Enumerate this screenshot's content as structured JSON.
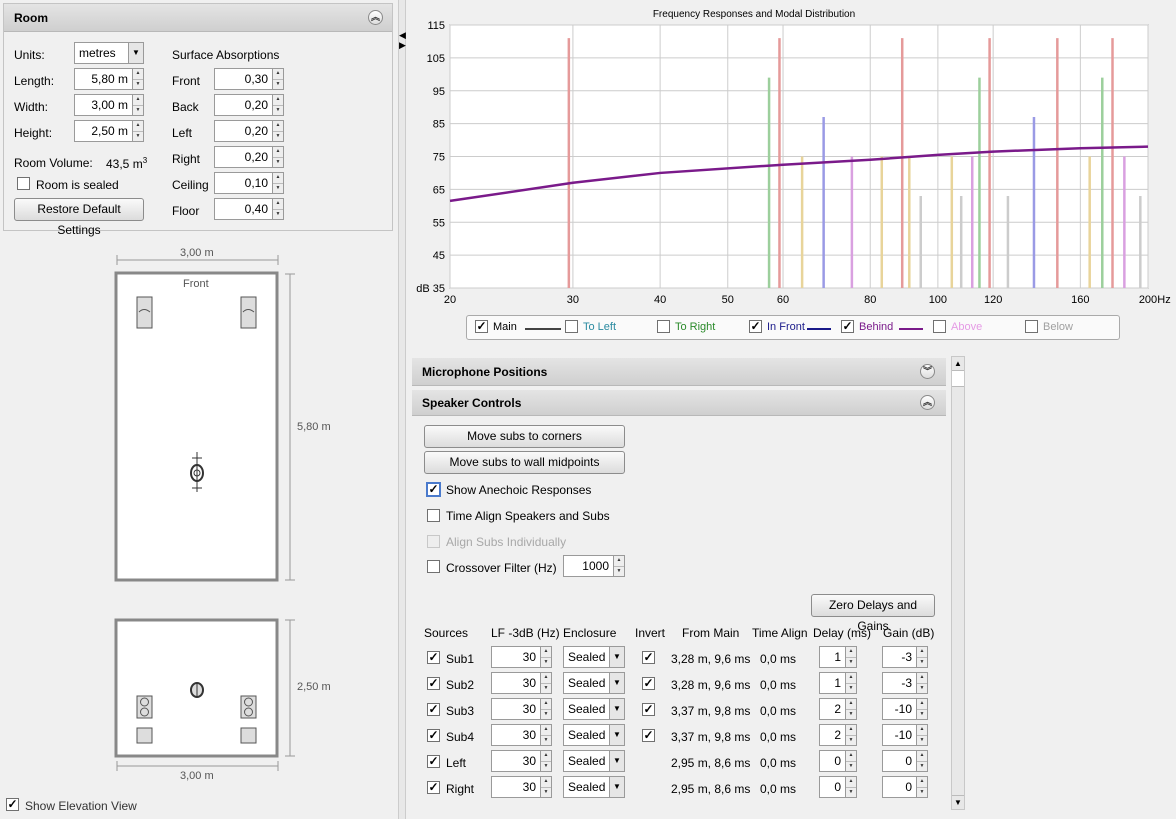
{
  "room_panel": {
    "title": "Room",
    "units_label": "Units:",
    "units_value": "metres",
    "length_label": "Length:",
    "length_value": "5,80 m",
    "width_label": "Width:",
    "width_value": "3,00 m",
    "height_label": "Height:",
    "height_value": "2,50 m",
    "volume_label": "Room Volume:",
    "volume_value": "43,5 m",
    "volume_sup": "3",
    "sealed_label": "Room is sealed",
    "restore_label": "Restore Default Settings",
    "absorb_title": "Surface Absorptions",
    "surfaces": [
      {
        "label": "Front",
        "value": "0,30"
      },
      {
        "label": "Back",
        "value": "0,20"
      },
      {
        "label": "Left",
        "value": "0,20"
      },
      {
        "label": "Right",
        "value": "0,20"
      },
      {
        "label": "Ceiling",
        "value": "0,10"
      },
      {
        "label": "Floor",
        "value": "0,40"
      }
    ]
  },
  "plan_view": {
    "top_dim": "3,00 m",
    "side_dim": "5,80 m",
    "front_label": "Front"
  },
  "elev_view": {
    "side_dim": "2,50 m",
    "bottom_dim": "3,00 m",
    "show_label": "Show Elevation View",
    "show_checked": true
  },
  "chart": {
    "title": "Frequency Responses and Modal Distribution",
    "y_unit": "dB",
    "x_unit": "Hz",
    "y_ticks": [
      "115",
      "105",
      "95",
      "85",
      "75",
      "65",
      "55",
      "45",
      "35"
    ],
    "x_ticks": [
      "20",
      "30",
      "40",
      "50",
      "60",
      "80",
      "100",
      "120",
      "160",
      "200"
    ]
  },
  "chart_data": {
    "type": "line",
    "title": "Frequency Responses and Modal Distribution",
    "xlabel": "Hz",
    "ylabel": "dB",
    "xlim": [
      20,
      200
    ],
    "ylim": [
      35,
      115
    ],
    "x_scale": "log",
    "grid": true,
    "legend_position": "bottom",
    "series": [
      {
        "name": "Behind",
        "color": "#7a1a8a",
        "x": [
          20,
          30,
          40,
          60,
          80,
          100,
          120,
          160,
          200
        ],
        "y": [
          61.5,
          67,
          70,
          72.5,
          74,
          75.5,
          76.5,
          77.5,
          78
        ]
      }
    ],
    "modes": [
      {
        "freq": 29.6,
        "level": 111,
        "color": "#e59a9a"
      },
      {
        "freq": 57.3,
        "level": 99,
        "color": "#9ccf9c"
      },
      {
        "freq": 59.3,
        "level": 111,
        "color": "#e59a9a"
      },
      {
        "freq": 63.9,
        "level": 75,
        "color": "#e8d49a"
      },
      {
        "freq": 68.6,
        "level": 87,
        "color": "#9a9ae5"
      },
      {
        "freq": 75.3,
        "level": 75,
        "color": "#d9a0e0"
      },
      {
        "freq": 83.1,
        "level": 75,
        "color": "#e8d49a"
      },
      {
        "freq": 88.9,
        "level": 111,
        "color": "#e59a9a"
      },
      {
        "freq": 91,
        "level": 75,
        "color": "#e8d49a"
      },
      {
        "freq": 94.5,
        "level": 63,
        "color": "#cccccc"
      },
      {
        "freq": 104.7,
        "level": 75,
        "color": "#e8d49a"
      },
      {
        "freq": 108,
        "level": 63,
        "color": "#cccccc"
      },
      {
        "freq": 112,
        "level": 75,
        "color": "#d9a0e0"
      },
      {
        "freq": 114.7,
        "level": 99,
        "color": "#9ccf9c"
      },
      {
        "freq": 118.6,
        "level": 111,
        "color": "#e59a9a"
      },
      {
        "freq": 126,
        "level": 63,
        "color": "#cccccc"
      },
      {
        "freq": 137.3,
        "level": 87,
        "color": "#9a9ae5"
      },
      {
        "freq": 148.3,
        "level": 111,
        "color": "#e59a9a"
      },
      {
        "freq": 165,
        "level": 75,
        "color": "#e8d49a"
      },
      {
        "freq": 172,
        "level": 99,
        "color": "#9ccf9c"
      },
      {
        "freq": 177.9,
        "level": 111,
        "color": "#e59a9a"
      },
      {
        "freq": 185,
        "level": 75,
        "color": "#d9a0e0"
      },
      {
        "freq": 195,
        "level": 63,
        "color": "#cccccc"
      }
    ]
  },
  "legend": [
    {
      "label": "Main",
      "checked": true,
      "color": "#444444",
      "line": true,
      "text_color": "#000000"
    },
    {
      "label": "To Left",
      "checked": false,
      "color": "#2a8aa0",
      "line": false,
      "text_color": "#2a8aa0"
    },
    {
      "label": "To Right",
      "checked": false,
      "color": "#2a8a2a",
      "line": false,
      "text_color": "#2a8a2a"
    },
    {
      "label": "In Front",
      "checked": true,
      "color": "#1a1a8a",
      "line": true,
      "text_color": "#1a1a8a"
    },
    {
      "label": "Behind",
      "checked": true,
      "color": "#7a1a8a",
      "line": true,
      "text_color": "#7a1a8a"
    },
    {
      "label": "Above",
      "checked": false,
      "color": "#e59ae5",
      "line": false,
      "text_color": "#e59ae5"
    },
    {
      "label": "Below",
      "checked": false,
      "color": "#a0a0a0",
      "line": false,
      "text_color": "#a0a0a0"
    }
  ],
  "mic_panel": {
    "title": "Microphone Positions"
  },
  "speaker_panel": {
    "title": "Speaker Controls",
    "btn_corners": "Move subs to corners",
    "btn_midpoints": "Move subs to wall midpoints",
    "anechoic_label": "Show Anechoic Responses",
    "time_align_label": "Time Align Speakers and Subs",
    "align_subs_label": "Align Subs Individually",
    "crossover_label": "Crossover Filter (Hz)",
    "crossover_value": "1000",
    "zero_label": "Zero Delays and Gains",
    "headers": [
      "Sources",
      "LF -3dB (Hz)",
      "Enclosure",
      "Invert",
      "From Main",
      "Time Align",
      "Delay (ms)",
      "Gain (dB)"
    ],
    "rows": [
      {
        "name": "Sub1",
        "lf": "30",
        "enclosure": "Sealed",
        "invert": true,
        "from_main": "3,28 m, 9,6 ms",
        "time_align": "0,0 ms",
        "delay": "1",
        "gain": "-3"
      },
      {
        "name": "Sub2",
        "lf": "30",
        "enclosure": "Sealed",
        "invert": true,
        "from_main": "3,28 m, 9,6 ms",
        "time_align": "0,0 ms",
        "delay": "1",
        "gain": "-3"
      },
      {
        "name": "Sub3",
        "lf": "30",
        "enclosure": "Sealed",
        "invert": true,
        "from_main": "3,37 m, 9,8 ms",
        "time_align": "0,0 ms",
        "delay": "2",
        "gain": "-10"
      },
      {
        "name": "Sub4",
        "lf": "30",
        "enclosure": "Sealed",
        "invert": true,
        "from_main": "3,37 m, 9,8 ms",
        "time_align": "0,0 ms",
        "delay": "2",
        "gain": "-10"
      },
      {
        "name": "Left",
        "lf": "30",
        "enclosure": "Sealed",
        "invert": false,
        "from_main": "2,95 m, 8,6 ms",
        "time_align": "0,0 ms",
        "delay": "0",
        "gain": "0"
      },
      {
        "name": "Right",
        "lf": "30",
        "enclosure": "Sealed",
        "invert": false,
        "from_main": "2,95 m, 8,6 ms",
        "time_align": "0,0 ms",
        "delay": "0",
        "gain": "0"
      }
    ]
  }
}
